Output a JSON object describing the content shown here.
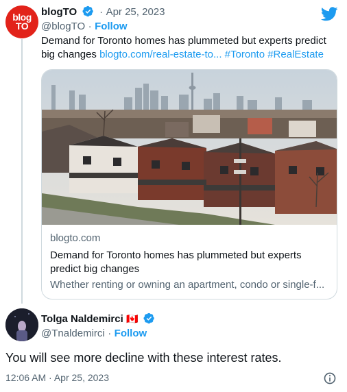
{
  "tweet": {
    "avatar_text_line1": "blog",
    "avatar_text_line2": "TO",
    "name": "blogTO",
    "date_sep": "·",
    "date": "Apr 25, 2023",
    "handle": "@blogTO",
    "handle_sep": "·",
    "follow_label": "Follow",
    "text_plain": "Demand for Toronto homes has plummeted but experts predict big changes",
    "link_text": "blogto.com/real-estate-to...",
    "hashtag1": "#Toronto",
    "hashtag2": "#RealEstate"
  },
  "card": {
    "domain": "blogto.com",
    "title": "Demand for Toronto homes has plummeted but experts predict big changes",
    "description": "Whether renting or owning an apartment, condo or single-f..."
  },
  "reply": {
    "name": "Tolga Naldemirci",
    "flag": "🇨🇦",
    "handle": "@Tnaldemirci",
    "handle_sep": "·",
    "follow_label": "Follow",
    "text": "You will see more decline with these interest rates.",
    "timestamp": "12:06 AM · Apr 25, 2023"
  },
  "colors": {
    "accent": "#1d9bf0",
    "blogto_red": "#e2231a",
    "muted": "#536471",
    "text": "#0f1419",
    "border": "#cfd9de"
  },
  "icons": [
    "twitter-bird-icon",
    "verified-badge-icon",
    "info-icon",
    "canada-flag-icon"
  ]
}
